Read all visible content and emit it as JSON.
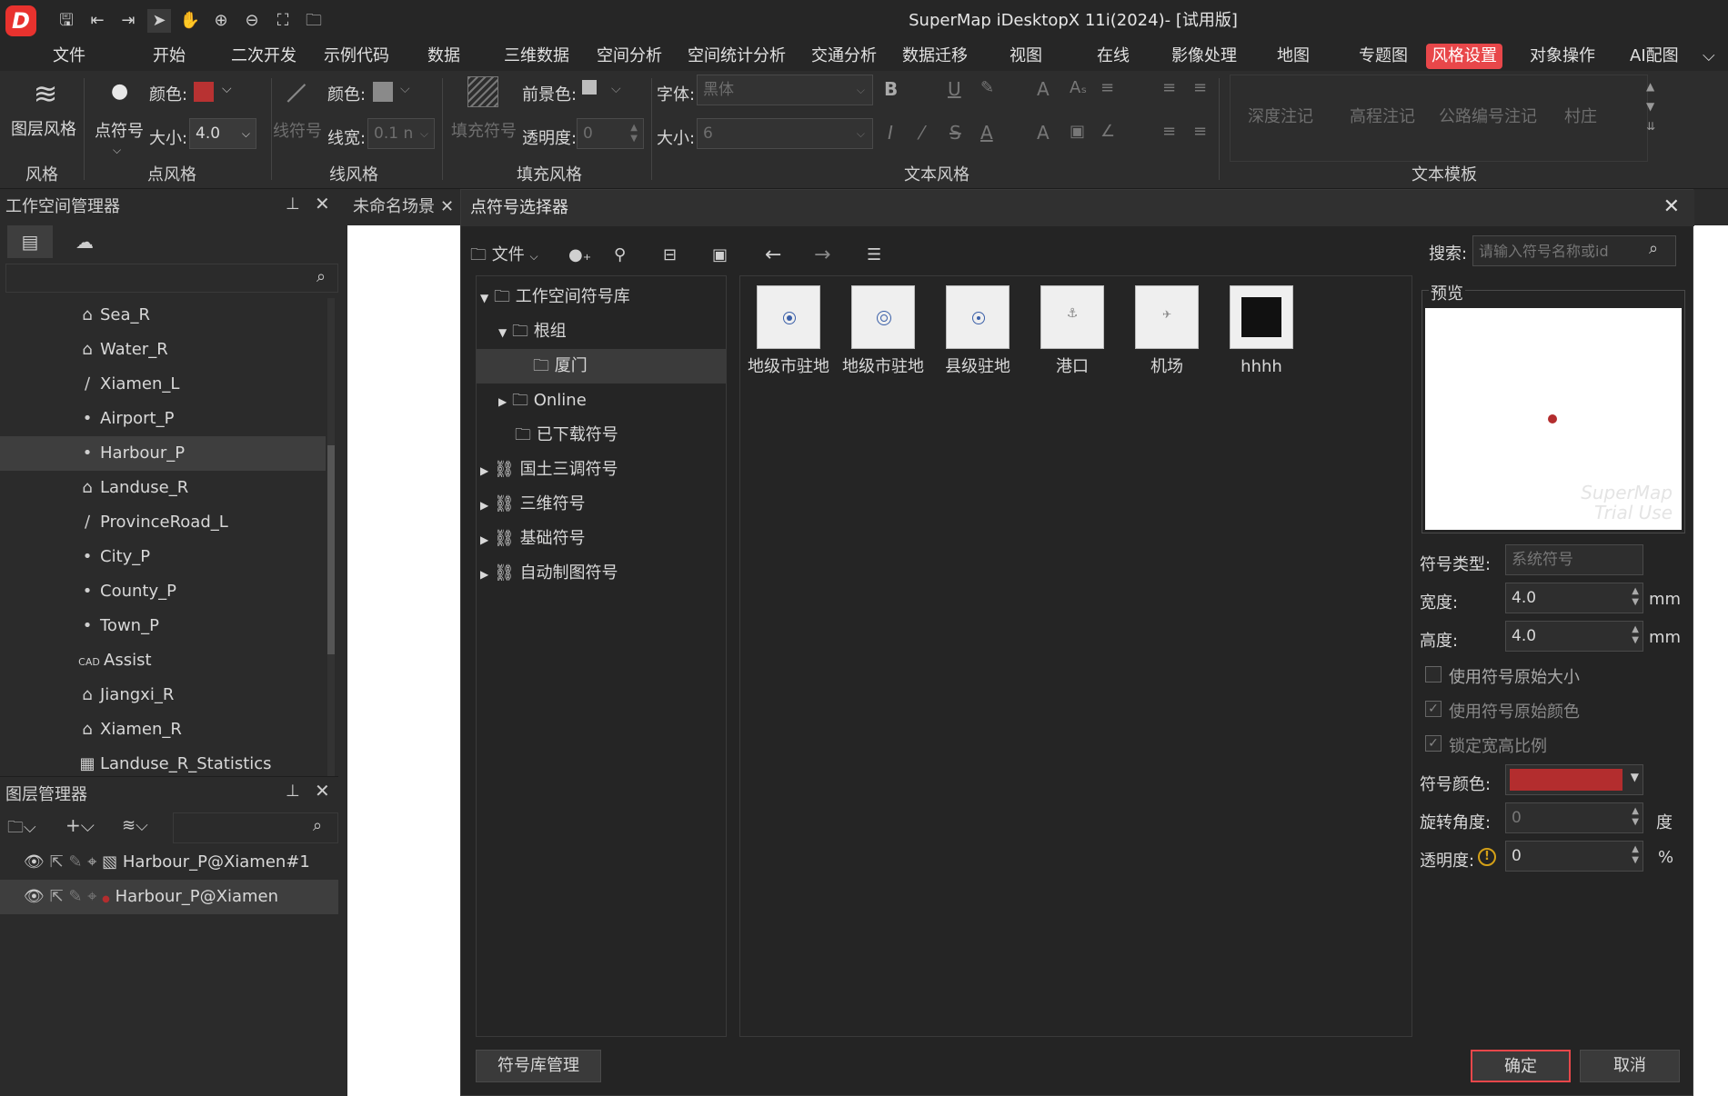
{
  "app": {
    "title": "SuperMap iDesktopX 11i(2024)- [试用版]",
    "logo": "D"
  },
  "menu": [
    "文件",
    "开始",
    "二次开发",
    "示例代码",
    "数据",
    "三维数据",
    "空间分析",
    "空间统计分析",
    "交通分析",
    "数据迁移",
    "视图",
    "在线",
    "影像处理",
    "地图",
    "专题图",
    "风格设置",
    "对象操作",
    "AI配图",
    "⌵"
  ],
  "menu_active": "风格设置",
  "ribbon": {
    "layer_style": "图层风格",
    "group_style": "风格",
    "point_symbol": "点符号",
    "color_label": "颜色:",
    "point_color": "#b83232",
    "size_label": "大小:",
    "point_size": "4.0",
    "group_point": "点风格",
    "line_symbol": "线符号",
    "line_color_label": "颜色:",
    "linewidth_label": "线宽:",
    "linewidth": "0.1 n",
    "group_line": "线风格",
    "fill_symbol": "填充符号",
    "fg_label": "前景色:",
    "transparency_label": "透明度:",
    "transparency": "0",
    "group_fill": "填充风格",
    "font_label": "字体:",
    "font": "黑体",
    "fontsize_label": "大小:",
    "fontsize": "6",
    "group_text": "文本风格",
    "templates": [
      "深度注记",
      "高程注记",
      "公路编号注记",
      "村庄"
    ],
    "group_template": "文本模板"
  },
  "workspace": {
    "title": "工作空间管理器",
    "items": [
      {
        "icon": "region",
        "label": "Sea_R"
      },
      {
        "icon": "region",
        "label": "Water_R"
      },
      {
        "icon": "line",
        "label": "Xiamen_L"
      },
      {
        "icon": "point",
        "label": "Airport_P"
      },
      {
        "icon": "point",
        "label": "Harbour_P"
      },
      {
        "icon": "region",
        "label": "Landuse_R"
      },
      {
        "icon": "line",
        "label": "ProvinceRoad_L"
      },
      {
        "icon": "point",
        "label": "City_P"
      },
      {
        "icon": "point",
        "label": "County_P"
      },
      {
        "icon": "point",
        "label": "Town_P"
      },
      {
        "icon": "cad",
        "label": "Assist"
      },
      {
        "icon": "region",
        "label": "Jiangxi_R"
      },
      {
        "icon": "region",
        "label": "Xiamen_R"
      },
      {
        "icon": "table",
        "label": "Landuse_R_Statistics"
      }
    ],
    "selected": "Harbour_P"
  },
  "layers": {
    "title": "图层管理器",
    "items": [
      "Harbour_P@Xiamen#1",
      "Harbour_P@Xiamen"
    ]
  },
  "scene_tab": "未命名场景",
  "dialog": {
    "title": "点符号选择器",
    "file_menu": "文件",
    "search_label": "搜索:",
    "search_placeholder": "请输入符号名称或id",
    "tree": {
      "workspace_lib": "工作空间符号库",
      "root_group": "根组",
      "xiamen": "厦门",
      "online": "Online",
      "downloaded": "已下载符号",
      "guotu": "国土三调符号",
      "threed": "三维符号",
      "basic": "基础符号",
      "auto": "自动制图符号"
    },
    "symbols": [
      "地级市驻地",
      "地级市驻地",
      "县级驻地",
      "港口",
      "机场",
      "hhhh"
    ],
    "preview_label": "预览",
    "preview_watermark": "SuperMap Trial Use",
    "props": {
      "type_label": "符号类型:",
      "type": "系统符号",
      "width_label": "宽度:",
      "width": "4.0",
      "height_label": "高度:",
      "height": "4.0",
      "unit_mm": "mm",
      "use_orig_size": "使用符号原始大小",
      "use_orig_color": "使用符号原始颜色",
      "lock_ratio": "锁定宽高比例",
      "color_label": "符号颜色:",
      "color": "#b32d2e",
      "rotation_label": "旋转角度:",
      "rotation": "0",
      "unit_deg": "度",
      "transparency_label": "透明度:",
      "transparency": "0",
      "unit_pct": "%"
    },
    "manage_button": "符号库管理",
    "ok_button": "确定",
    "cancel_button": "取消"
  }
}
